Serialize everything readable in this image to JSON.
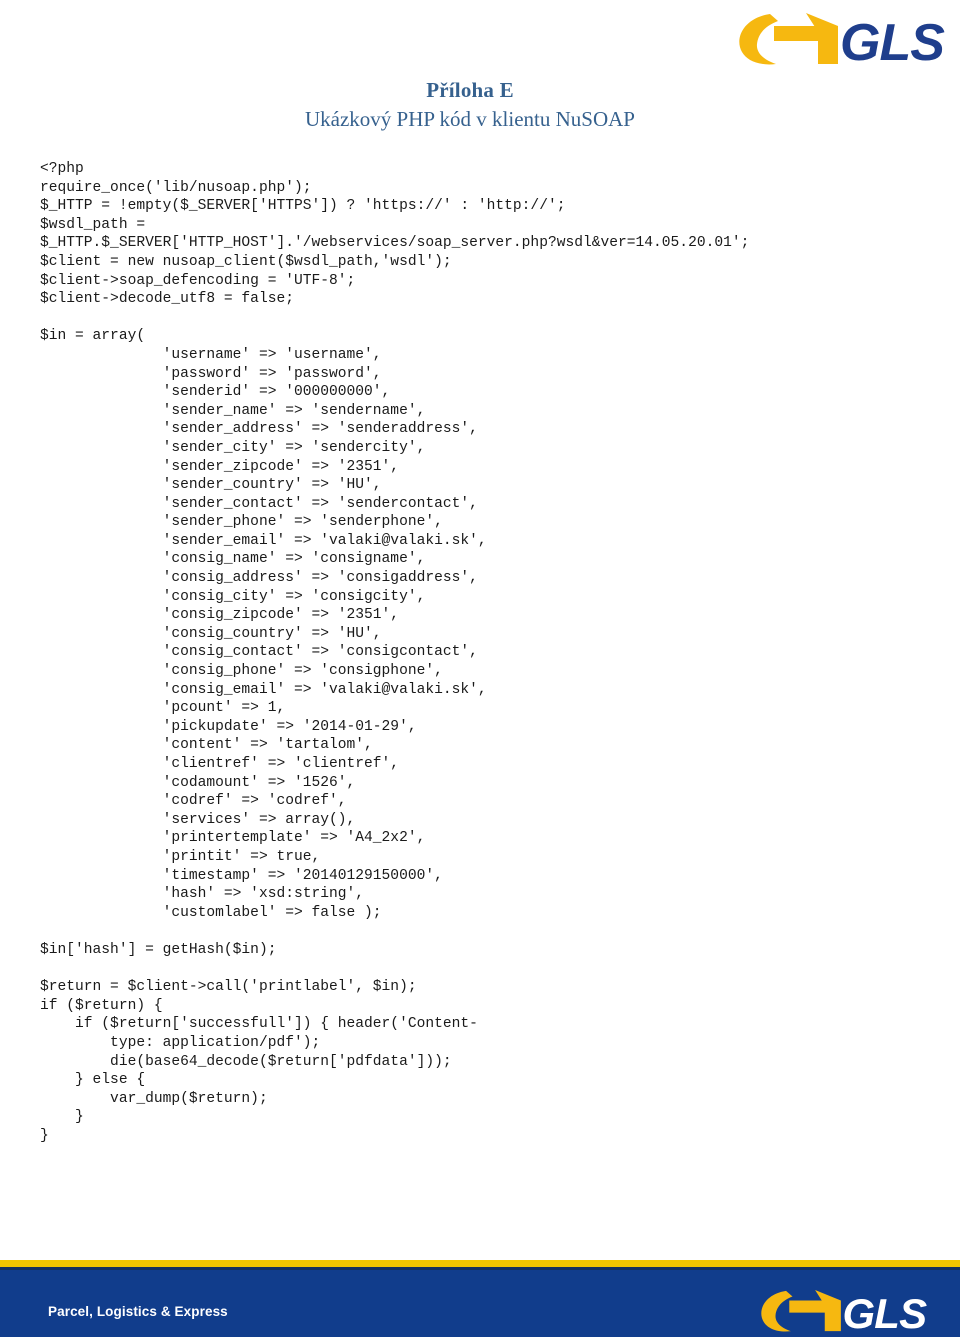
{
  "header": {
    "logo_name": "gls-logo",
    "title": "Příloha E",
    "subtitle": "Ukázkový PHP kód v klientu NuSOAP",
    "title_color": "#36618e"
  },
  "code": {
    "language": "php",
    "lines": [
      "<?php",
      "require_once('lib/nusoap.php');",
      "$_HTTP = !empty($_SERVER['HTTPS']) ? 'https://' : 'http://';",
      "$wsdl_path =",
      "$_HTTP.$_SERVER['HTTP_HOST'].'/webservices/soap_server.php?wsdl&ver=14.05.20.01';",
      "$client = new nusoap_client($wsdl_path,'wsdl');",
      "$client->soap_defencoding = 'UTF-8';",
      "$client->decode_utf8 = false;",
      "",
      "$in = array(",
      "              'username' => 'username',",
      "              'password' => 'password',",
      "              'senderid' => '000000000',",
      "              'sender_name' => 'sendername',",
      "              'sender_address' => 'senderaddress',",
      "              'sender_city' => 'sendercity',",
      "              'sender_zipcode' => '2351',",
      "              'sender_country' => 'HU',",
      "              'sender_contact' => 'sendercontact',",
      "              'sender_phone' => 'senderphone',",
      "              'sender_email' => 'valaki@valaki.sk',",
      "              'consig_name' => 'consigname',",
      "              'consig_address' => 'consigaddress',",
      "              'consig_city' => 'consigcity',",
      "              'consig_zipcode' => '2351',",
      "              'consig_country' => 'HU',",
      "              'consig_contact' => 'consigcontact',",
      "              'consig_phone' => 'consigphone',",
      "              'consig_email' => 'valaki@valaki.sk',",
      "              'pcount' => 1,",
      "              'pickupdate' => '2014-01-29',",
      "              'content' => 'tartalom',",
      "              'clientref' => 'clientref',",
      "              'codamount' => '1526',",
      "              'codref' => 'codref',",
      "              'services' => array(),",
      "              'printertemplate' => 'A4_2x2',",
      "              'printit' => true,",
      "              'timestamp' => '20140129150000',",
      "              'hash' => 'xsd:string',",
      "              'customlabel' => false );",
      "",
      "$in['hash'] = getHash($in);",
      "",
      "$return = $client->call('printlabel', $in);",
      "if ($return) {",
      "    if ($return['successfull']) { header('Content-",
      "        type: application/pdf');",
      "        die(base64_decode($return['pdfdata']));",
      "    } else {",
      "        var_dump($return);",
      "    }",
      "}"
    ]
  },
  "footer": {
    "tagline": "Parcel, Logistics & Express",
    "logo_name": "gls-logo",
    "stripe_color": "#F2C500",
    "bar_color": "#113d8c"
  }
}
